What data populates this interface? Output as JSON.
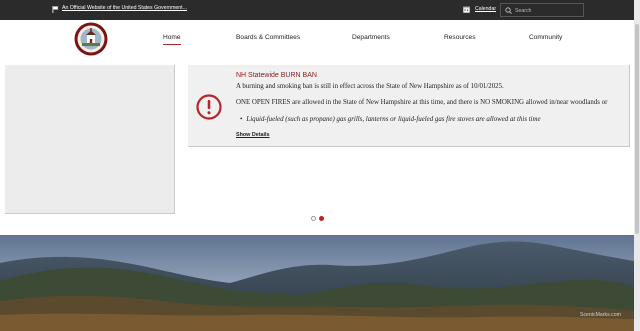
{
  "topbar": {
    "gov_link": "An Official Website of the United States Government...",
    "calendar_label": "Calendar",
    "search_placeholder": "Search"
  },
  "nav": {
    "items": [
      {
        "label": "Home",
        "active": true
      },
      {
        "label": "Boards & Committees"
      },
      {
        "label": "Departments"
      },
      {
        "label": "Resources"
      },
      {
        "label": "Community"
      }
    ]
  },
  "alert": {
    "title": "NH Statewide BURN BAN",
    "p1": "A burning and smoking ban is still in effect across the State of New Hampshire as of 10/01/2025.",
    "p2": "ONE OPEN FIRES are allowed in the State of New Hampshire at this time, and there is NO SMOKING allowed in/near woodlands or",
    "bullet": "Liquid-fueled (such as propane) gas grills, lanterns or liquid-fueled gas fire stoves are allowed at this time",
    "show_details": "Show Details"
  },
  "carousel": {
    "active_slide": 2,
    "slide_count": 2
  },
  "hero": {
    "watermark": "ScenicMarks.com"
  },
  "colors": {
    "accent": "#b5262a",
    "topbar": "#2b2b2b",
    "alert_title": "#8a1c1c"
  }
}
